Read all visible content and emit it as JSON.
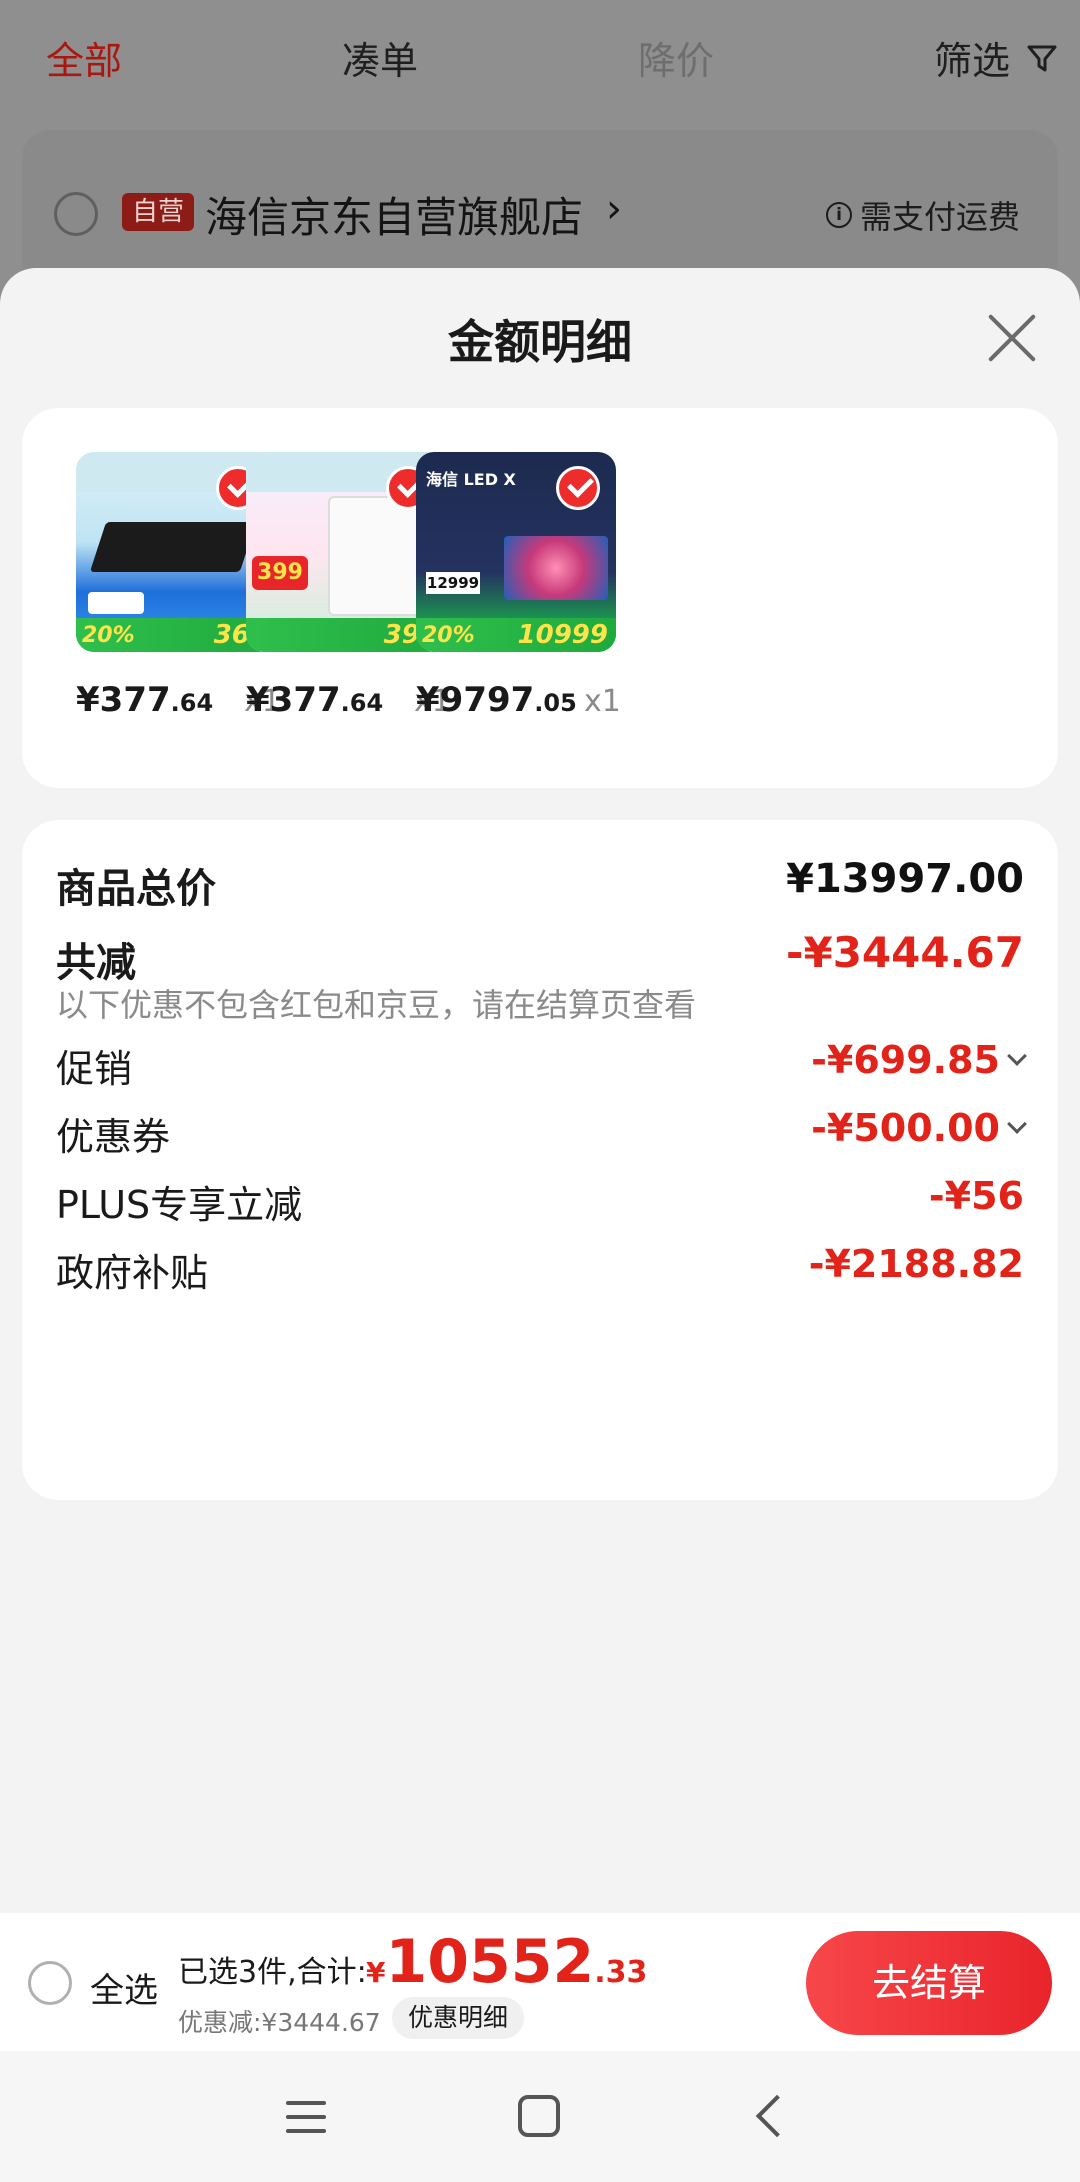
{
  "background": {
    "tabs": [
      "全部",
      "凑单",
      "降价",
      "筛选"
    ],
    "store": {
      "badge": "自营",
      "name": "海信京东自营旗舰店",
      "chevron": "›",
      "shipping_note": "需支付运费",
      "info_icon": "i"
    }
  },
  "sheet": {
    "title": "金额明细",
    "products": [
      {
        "thumb_labels": {
          "corner": "369",
          "left": "20%"
        },
        "price_int": "¥377",
        "price_dec": ".64",
        "qty": "x1"
      },
      {
        "thumb_labels": {
          "corner": "399",
          "left": "399"
        },
        "price_int": "¥377",
        "price_dec": ".64",
        "qty": "x1"
      },
      {
        "thumb_labels": {
          "corner": "10999",
          "left": "20%",
          "title": "海信 LED X",
          "price": "12999"
        },
        "price_int": "¥9797",
        "price_dec": ".05",
        "qty": "x1"
      }
    ],
    "summary": {
      "total_label": "商品总价",
      "total_value": "¥13997.00",
      "reduced_label": "共减",
      "reduced_value": "-¥3444.67",
      "note": "以下优惠不包含红包和京豆，请在结算页查看",
      "promo_label": "促销",
      "promo_value": "-¥699.85",
      "coupon_label": "优惠券",
      "coupon_value": "-¥500.00",
      "plus_label": "PLUS专享立减",
      "plus_value": "-¥56",
      "subsidy_label": "政府补贴",
      "subsidy_value": "-¥2188.82"
    }
  },
  "bottom_bar": {
    "select_all": "全选",
    "selected_text": "已选3件,合计:",
    "total_currency": "¥",
    "total_int": "10552",
    "total_dec": ".33",
    "discount_text": "优惠减:¥3444.67",
    "detail_pill": "优惠明细",
    "checkout": "去结算"
  },
  "colors": {
    "accent_red": "#e2231a",
    "checkout_gradient_start": "#f7474a",
    "checkout_gradient_end": "#e9242b"
  },
  "icons": [
    "filter-icon",
    "info-icon",
    "close-icon",
    "check-icon",
    "chevron-down-icon",
    "menu-icon",
    "home-icon",
    "back-icon"
  ]
}
